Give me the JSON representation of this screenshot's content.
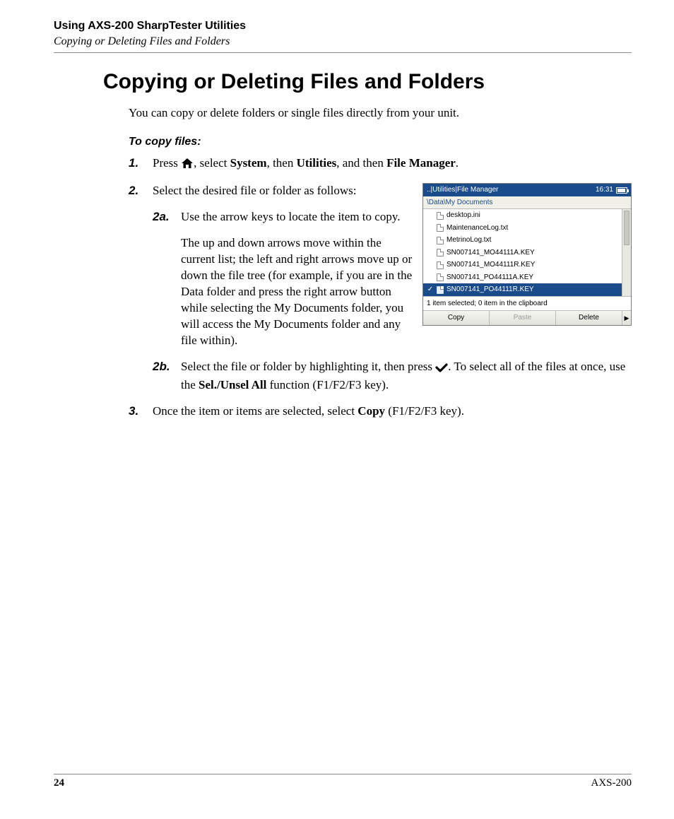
{
  "header": {
    "chapter": "Using AXS-200 SharpTester Utilities",
    "section": "Copying or Deleting Files and Folders"
  },
  "title": "Copying or Deleting Files and Folders",
  "intro": "You can copy or delete folders or single files directly from your unit.",
  "subhead": "To copy files:",
  "step1": {
    "num": "1.",
    "a": "Press ",
    "b": ", select ",
    "system": "System",
    "c": ", then ",
    "utilities": "Utilities",
    "d": ", and then ",
    "fm": "File Manager",
    "e": "."
  },
  "step2": {
    "num": "2.",
    "text": "Select the desired file or folder as follows:"
  },
  "step2a": {
    "num": "2a.",
    "p1": "Use the arrow keys to locate the item to copy.",
    "p2": "The up and down arrows move within the current list; the left and right arrows move up or down the file tree (for example, if you are in the Data folder and press the right arrow button while selecting the My Documents folder, you will access the My Documents folder and any file within)."
  },
  "step2b": {
    "num": "2b.",
    "a": "Select the file or folder by highlighting it, then press ",
    "b": ". To select all of the files at once, use the ",
    "sel": "Sel./Unsel All",
    "c": " function (F1/F2/F3 key)."
  },
  "step3": {
    "num": "3.",
    "a": "Once the item or items are selected, select ",
    "copy": "Copy",
    "b": " (F1/F2/F3 key)."
  },
  "screenshot": {
    "breadcrumb": "..|Utilities|File Manager",
    "time": "16:31",
    "path": "\\Data\\My Documents",
    "files": [
      "desktop.ini",
      "MaintenanceLog.txt",
      "MetrinoLog.txt",
      "SN007141_MO44111A.KEY",
      "SN007141_MO44111R.KEY",
      "SN007141_PO44111A.KEY",
      "SN007141_PO44111R.KEY"
    ],
    "selected_index": 6,
    "status": "1 item selected; 0 item in the clipboard",
    "buttons": {
      "copy": "Copy",
      "paste": "Paste",
      "delete": "Delete"
    }
  },
  "footer": {
    "page": "24",
    "product": "AXS-200"
  }
}
